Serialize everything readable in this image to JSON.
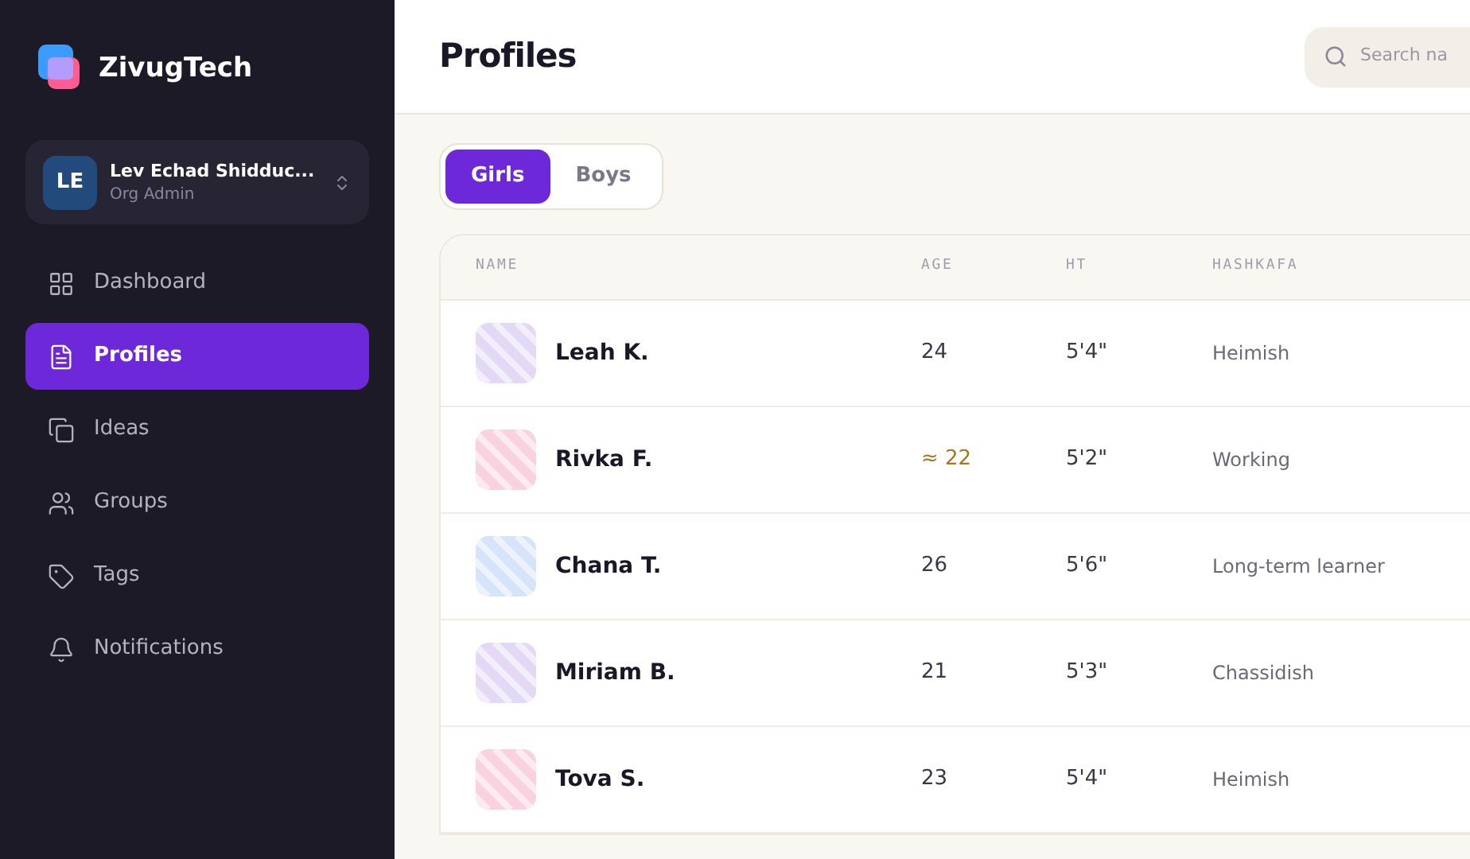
{
  "brand": {
    "name": "ZivugTech"
  },
  "account": {
    "initials": "LE",
    "name": "Lev Echad Shidduc...",
    "role": "Org Admin"
  },
  "nav": [
    {
      "label": "Dashboard",
      "kind": "grid",
      "selected": false
    },
    {
      "label": "Profiles",
      "kind": "file",
      "selected": true
    },
    {
      "label": "Ideas",
      "kind": "copy",
      "selected": false
    },
    {
      "label": "Groups",
      "kind": "users",
      "selected": false
    },
    {
      "label": "Tags",
      "kind": "tag",
      "selected": false
    },
    {
      "label": "Notifications",
      "kind": "bell",
      "selected": false
    }
  ],
  "page_title": "Profiles",
  "search": {
    "placeholder": "Search na"
  },
  "tabs": [
    {
      "label": "Girls",
      "selected": true
    },
    {
      "label": "Boys",
      "selected": false
    }
  ],
  "table": {
    "columns": [
      "NAME",
      "AGE",
      "HT",
      "HASHKAFA"
    ],
    "rows": [
      {
        "name": "Leah K.",
        "color": "#e4d9f5",
        "age": "24",
        "age_approximate": false,
        "height": "5'4\"",
        "hashkafa": "Heimish"
      },
      {
        "name": "Rivka F.",
        "color": "#f8d3df",
        "age": "≈ 22",
        "age_approximate": true,
        "height": "5'2\"",
        "hashkafa": "Working"
      },
      {
        "name": "Chana T.",
        "color": "#d5e4f8",
        "age": "26",
        "age_approximate": false,
        "height": "5'6\"",
        "hashkafa": "Long-term learner"
      },
      {
        "name": "Miriam B.",
        "color": "#e4d9f5",
        "age": "21",
        "age_approximate": false,
        "height": "5'3\"",
        "hashkafa": "Chassidish"
      },
      {
        "name": "Tova S.",
        "color": "#f8d3df",
        "age": "23",
        "age_approximate": false,
        "height": "5'4\"",
        "hashkafa": "Heimish"
      }
    ]
  }
}
